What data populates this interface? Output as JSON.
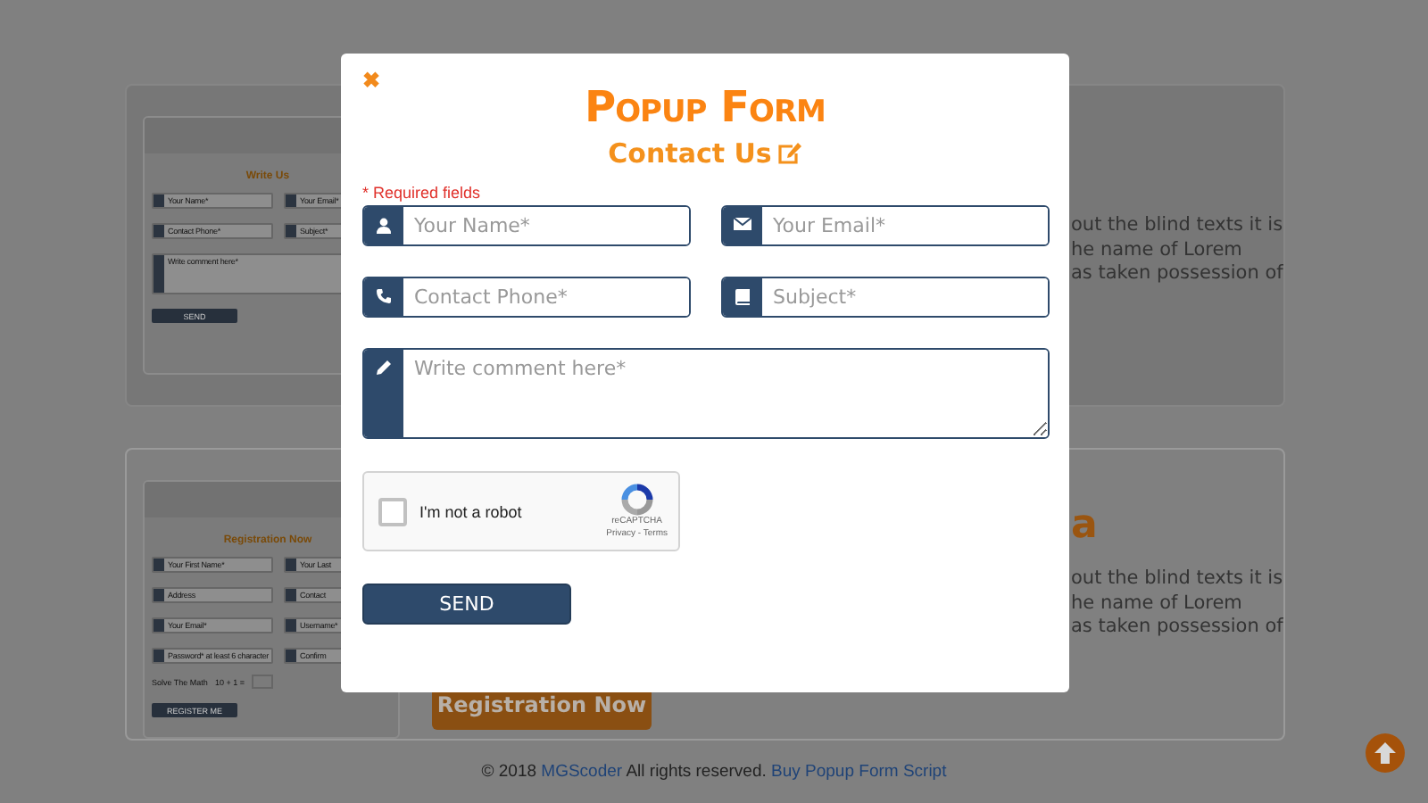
{
  "background_cards": [
    {
      "thumbnail": {
        "title": "Write Us",
        "fields": [
          {
            "placeholder": "Your Name*",
            "kind": "input"
          },
          {
            "placeholder": "Your Email*",
            "kind": "input"
          },
          {
            "placeholder": "Contact Phone*",
            "kind": "input"
          },
          {
            "placeholder": "Subject*",
            "kind": "input"
          },
          {
            "placeholder": "Write comment here*",
            "kind": "textarea"
          }
        ],
        "button": "SEND"
      },
      "text_lines": [
        "out the blind texts it is",
        "he name of Lorem",
        "as taken possession of"
      ]
    },
    {
      "thumbnail": {
        "title": "Registration Now",
        "fields": [
          {
            "placeholder": "Your First Name*",
            "kind": "input"
          },
          {
            "placeholder": "Your Last",
            "kind": "input"
          },
          {
            "placeholder": "Address",
            "kind": "input"
          },
          {
            "placeholder": "Contact",
            "kind": "input"
          },
          {
            "placeholder": "Your Email*",
            "kind": "input"
          },
          {
            "placeholder": "Username*",
            "kind": "input"
          },
          {
            "placeholder": "Password* at least 6 character",
            "kind": "input"
          },
          {
            "placeholder": "Confirm",
            "kind": "input"
          }
        ],
        "math_label": "Solve The Math",
        "math_question": "10 + 1 =",
        "button": "REGISTER ME"
      },
      "heading": "a",
      "text_lines": [
        "out the blind texts it is",
        "he name of Lorem",
        "as taken possession of"
      ],
      "button": "Registration Now"
    }
  ],
  "popup": {
    "close": "✖",
    "title": "Popup Form",
    "subtitle": "Contact Us",
    "required_note": "* Required fields",
    "fields": [
      {
        "placeholder": "Your Name*",
        "kind": "input"
      },
      {
        "placeholder": "Your Email*",
        "kind": "input"
      },
      {
        "placeholder": "Contact Phone*",
        "kind": "input"
      },
      {
        "placeholder": "Subject*",
        "kind": "input"
      },
      {
        "placeholder": "Write comment here*",
        "kind": "textarea"
      }
    ],
    "captcha": {
      "label": "I'm not a robot",
      "checked": false,
      "brand": "reCAPTCHA",
      "links": "Privacy - Terms"
    },
    "submit": "SEND"
  },
  "footer": {
    "copyright": "© 2018",
    "author_link": "MGScoder",
    "rights": "All rights reserved.",
    "buy_link": "Buy Popup Form Script"
  }
}
